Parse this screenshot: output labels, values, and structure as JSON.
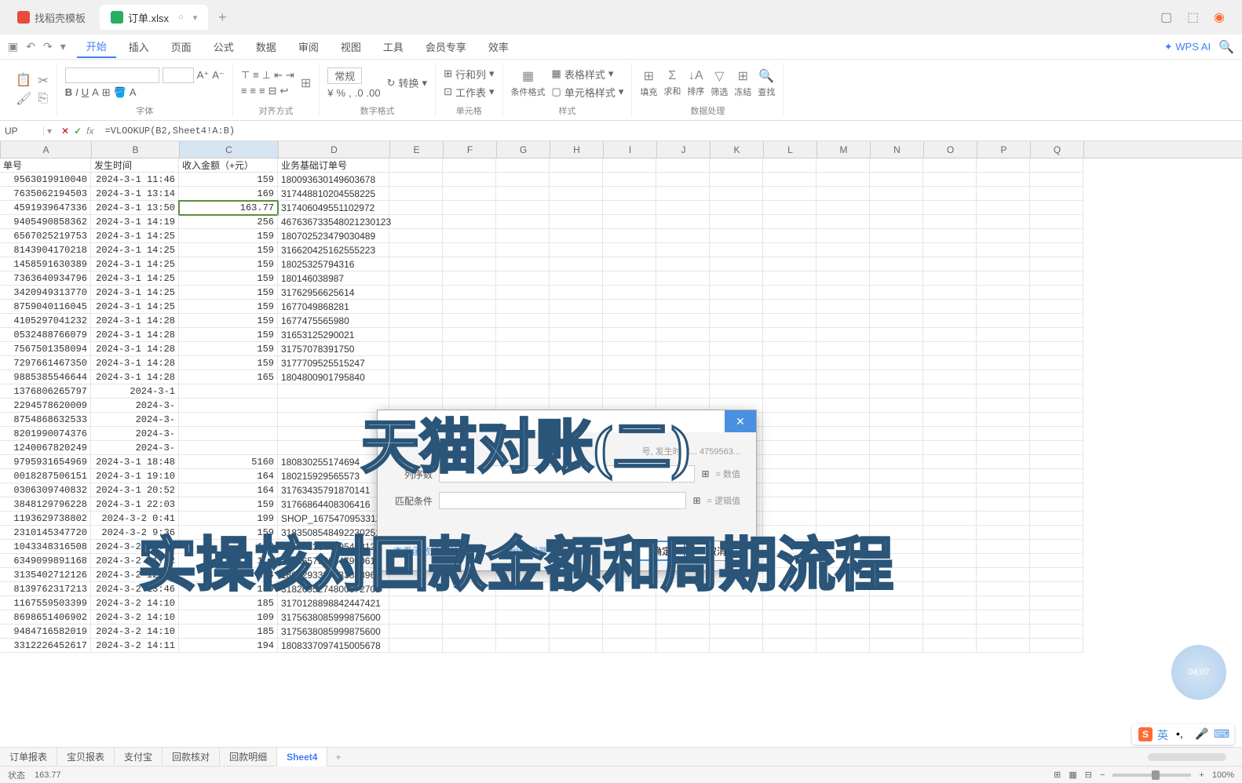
{
  "tabs": [
    {
      "icon": "red",
      "label": "找稻壳模板"
    },
    {
      "icon": "green",
      "label": "订单.xlsx",
      "active": true
    }
  ],
  "ribbon_tabs": [
    "开始",
    "插入",
    "页面",
    "公式",
    "数据",
    "审阅",
    "视图",
    "工具",
    "会员专享",
    "效率"
  ],
  "active_ribbon_tab": "开始",
  "wps_ai": "WPS AI",
  "ribbon_groups": {
    "font_label": "字体",
    "align_label": "对齐方式",
    "number_label": "数字格式",
    "cell_label": "单元格",
    "style_label": "样式",
    "data_label": "数据处理",
    "format_general": "常规",
    "convert": "转换",
    "rowcol": "行和列",
    "worksheet": "工作表",
    "condfmt": "条件格式",
    "tablestyle": "表格样式",
    "cellstyle": "单元格样式",
    "fill": "填充",
    "sum": "求和",
    "sort": "排序",
    "filter": "筛选",
    "freeze": "冻结",
    "find": "查找"
  },
  "name_box": "UP",
  "formula": "=VLOOKUP(B2,Sheet4!A:B)",
  "columns": [
    "A",
    "B",
    "C",
    "D",
    "E",
    "F",
    "G",
    "H",
    "I",
    "J",
    "K",
    "L",
    "M",
    "N",
    "O",
    "P",
    "Q"
  ],
  "headers": {
    "A": "单号",
    "B": "发生时间",
    "C": "收入金额（+元）",
    "D": "业务基础订单号"
  },
  "rows": [
    {
      "A": "9563019910040",
      "B": "2024-3-1 11:46",
      "C": "159",
      "D": "180093630149603678"
    },
    {
      "A": "7635062194503",
      "B": "2024-3-1 13:14",
      "C": "169",
      "D": "317448810204558225"
    },
    {
      "A": "4591939647336",
      "B": "2024-3-1 13:50",
      "C": "163.77",
      "D": "317406049551102972",
      "active": true
    },
    {
      "A": "9405490858362",
      "B": "2024-3-1 14:19",
      "C": "256",
      "D": "467636733548021230123"
    },
    {
      "A": "6567025219753",
      "B": "2024-3-1 14:25",
      "C": "159",
      "D": "180702523479030489"
    },
    {
      "A": "8143904170218",
      "B": "2024-3-1 14:25",
      "C": "159",
      "D": "316620425162555223"
    },
    {
      "A": "1458591630389",
      "B": "2024-3-1 14:25",
      "C": "159",
      "D": "18025325794316"
    },
    {
      "A": "7363640934796",
      "B": "2024-3-1 14:25",
      "C": "159",
      "D": "180146038987"
    },
    {
      "A": "3420949313770",
      "B": "2024-3-1 14:25",
      "C": "159",
      "D": "31762956625614"
    },
    {
      "A": "8759040116045",
      "B": "2024-3-1 14:25",
      "C": "159",
      "D": "1677049868281"
    },
    {
      "A": "4105297041232",
      "B": "2024-3-1 14:28",
      "C": "159",
      "D": "1677475565980"
    },
    {
      "A": "0532488766079",
      "B": "2024-3-1 14:28",
      "C": "159",
      "D": "31653125290021"
    },
    {
      "A": "7567501358094",
      "B": "2024-3-1 14:28",
      "C": "159",
      "D": "31757078391750"
    },
    {
      "A": "7297661467350",
      "B": "2024-3-1 14:28",
      "C": "159",
      "D": "3177709525515247"
    },
    {
      "A": "9885385546644",
      "B": "2024-3-1 14:28",
      "C": "165",
      "D": "1804800901795840"
    },
    {
      "A": "1376806265797",
      "B": "2024-3-1",
      "C": "",
      "D": ""
    },
    {
      "A": "2294578620009",
      "B": "2024-3-",
      "C": "",
      "D": ""
    },
    {
      "A": "8754868632533",
      "B": "2024-3-",
      "C": "",
      "D": ""
    },
    {
      "A": "8201990074376",
      "B": "2024-3-",
      "C": "",
      "D": ""
    },
    {
      "A": "1240067820249",
      "B": "2024-3-",
      "C": "",
      "D": ""
    },
    {
      "A": "9795931654969",
      "B": "2024-3-1 18:48",
      "C": "5160",
      "D": "180830255174694"
    },
    {
      "A": "0018287506151",
      "B": "2024-3-1 19:10",
      "C": "164",
      "D": "180215929565573"
    },
    {
      "A": "0306309740832",
      "B": "2024-3-1 20:52",
      "C": "164",
      "D": "31763435791870141"
    },
    {
      "A": "3848129796228",
      "B": "2024-3-1 22:03",
      "C": "159",
      "D": "31766864408306416"
    },
    {
      "A": "1193629738802",
      "B": "2024-3-2 0:41",
      "C": "199",
      "D": "SHOP_1675470953312_e395bed8eeaceaab24cdf5a2a8e90ed0_0_sbq"
    },
    {
      "A": "2310145347720",
      "B": "2024-3-2 9:36",
      "C": "159",
      "D": "3183508548492230251"
    },
    {
      "A": "1043348316508",
      "B": "2024-3-2 10:01",
      "C": "143",
      "D": "3167723844295408125"
    },
    {
      "A": "6349099891168",
      "B": "2024-3-2 11:12",
      "C": "157",
      "D": "3175657560847900610"
    },
    {
      "A": "3135402712126",
      "B": "2024-3-2 12:24",
      "C": "164",
      "D": "1807293327333828968"
    },
    {
      "A": "8139762317213",
      "B": "2024-3-2 13:46",
      "C": "169",
      "D": "3182695274800872701"
    },
    {
      "A": "1167559503399",
      "B": "2024-3-2 14:10",
      "C": "185",
      "D": "3170128898842447421"
    },
    {
      "A": "8698651406902",
      "B": "2024-3-2 14:10",
      "C": "109",
      "D": "3175638085999875600"
    },
    {
      "A": "9484716582019",
      "B": "2024-3-2 14:10",
      "C": "185",
      "D": "3175638085999875600"
    },
    {
      "A": "3312226452617",
      "B": "2024-3-2 14:11",
      "C": "194",
      "D": "1808337097415005678"
    }
  ],
  "dialog": {
    "hint_text": "号, 发生时间... 4759563...",
    "row1_label": "列序数",
    "row1_eq": "= 数值",
    "row2_label": "匹配条件",
    "row2_eq": "= 逻辑值",
    "link1": "查看函数操作技巧",
    "link2": "多列匹配录入",
    "ok": "确定",
    "cancel": "取消"
  },
  "overlays": {
    "line1": "天猫对账(二)",
    "line2": "实操核对回款金额和周期流程"
  },
  "sheets": [
    "订单报表",
    "宝贝报表",
    "支付宝",
    "回款核对",
    "回款明细",
    "Sheet4"
  ],
  "active_sheet": "Sheet4",
  "status": {
    "mode": "状态",
    "value": "163.77",
    "zoom": "100%",
    "time": "04:07"
  },
  "ime": {
    "s": "S",
    "lang": "英"
  }
}
